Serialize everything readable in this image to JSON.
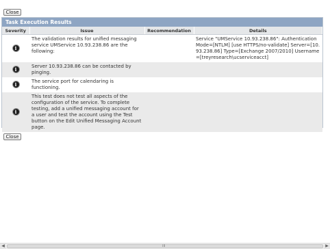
{
  "buttons": {
    "close": "Close"
  },
  "panel": {
    "title": "Task Execution Results",
    "columns": [
      "Severity",
      "Issue",
      "Recommendation",
      "Details"
    ]
  },
  "rows": [
    {
      "severity_icon": "info-icon",
      "issue": "The validation results for unified messaging service UMService 10.93.238.86 are the following:",
      "recommendation": "",
      "details": "Service \"UMService 10.93.238.86\": AuthenticationMode=[NTLM] [use HTTPS/no-validate] Server=[10.93.238.86] Type=[Exchange 2007/2010] Username=[treyresearch\\ucserviceacct]"
    },
    {
      "severity_icon": "info-icon",
      "issue": "Server 10.93.238.86 can be contacted by pinging.",
      "recommendation": "",
      "details": ""
    },
    {
      "severity_icon": "info-icon",
      "issue": "The service port for calendaring is functioning.",
      "recommendation": "",
      "details": ""
    },
    {
      "severity_icon": "info-icon",
      "issue": "This test does not test all aspects of the configuration of the service. To complete testing, add a unified messaging account for a user and test the account using the Test button on the Edit Unified Messaging Account page.",
      "recommendation": "",
      "details": ""
    }
  ],
  "scrollbar": {
    "grip": "III"
  }
}
